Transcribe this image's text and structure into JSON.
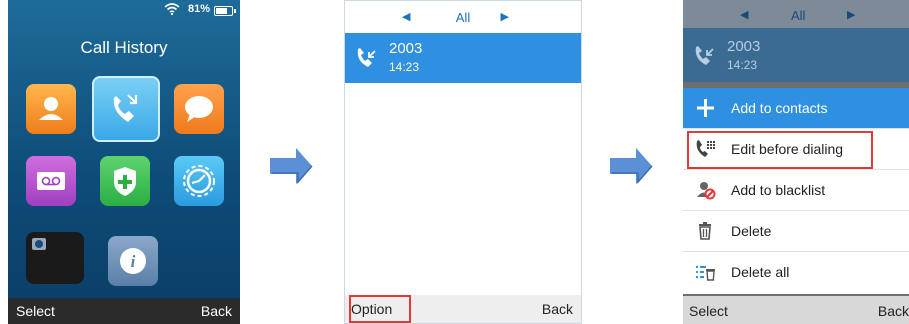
{
  "screen1": {
    "status": {
      "battery_pct": "81%"
    },
    "title": "Call History",
    "softkeys": {
      "left": "Select",
      "right": "Back"
    }
  },
  "screen2": {
    "filter_tab": "All",
    "entry": {
      "number": "2003",
      "time": "14:23"
    },
    "softkeys": {
      "left": "Option",
      "right": "Back"
    }
  },
  "screen3": {
    "filter_tab": "All",
    "entry": {
      "number": "2003",
      "time": "14:23"
    },
    "menu": [
      {
        "label": "Add to contacts"
      },
      {
        "label": "Edit before dialing"
      },
      {
        "label": "Add to blacklist"
      },
      {
        "label": "Delete"
      },
      {
        "label": "Delete all"
      }
    ],
    "softkeys": {
      "left": "Select",
      "right": "Back"
    }
  },
  "colors": {
    "accent": "#2f8fe0",
    "highlight": "#e53935",
    "arrow": "#5b8fd6"
  }
}
